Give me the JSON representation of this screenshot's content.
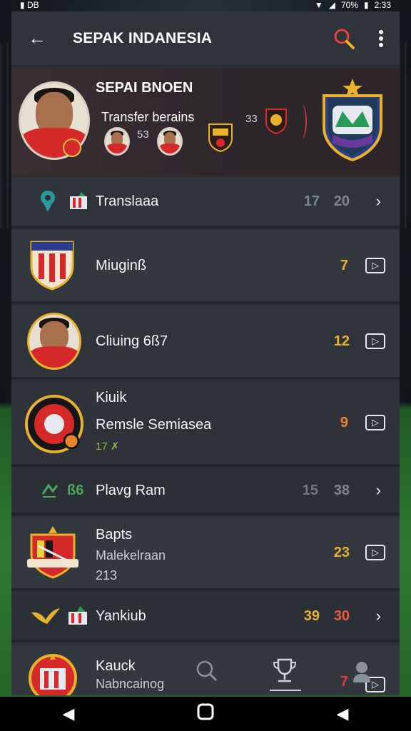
{
  "status": {
    "left": "▮ DB",
    "battery": "70%",
    "time": "2:33"
  },
  "appbar": {
    "title": "SEPAK INDANESIA"
  },
  "hero": {
    "name": "SEPAI BNOEN",
    "subtitle": "Transfer berains",
    "num1": "53",
    "num2": "33"
  },
  "rows": [
    {
      "label": "Translaaa",
      "value1": "17",
      "value2": "20",
      "color1": "#7d8590",
      "color2": "#7d8590"
    },
    {
      "label": "Miuginß",
      "value1": "7",
      "color1": "#e8b22a"
    },
    {
      "label": "Cliuing 6ß7",
      "value1": "12",
      "color1": "#e8b22a"
    },
    {
      "label": "Kiuik",
      "sub": "Remsle Semiasea",
      "tag": "17 ✗",
      "value1": "9",
      "color1": "#e8842a"
    },
    {
      "label": "Plavg Ram",
      "prefix": "ß6",
      "value1": "15",
      "value2": "38",
      "color1": "#6e7781",
      "color2": "#7d8590"
    },
    {
      "label": "Bapts",
      "sub": "Malekelraan",
      "tag": "213",
      "value1": "23",
      "color1": "#e8b22a"
    },
    {
      "label": "Yankiub",
      "value1": "39",
      "value2": "30",
      "color1": "#e8b22a",
      "color2": "#e85a3a"
    },
    {
      "label": "Kauck",
      "sub": "Nabncainog",
      "value1": "7",
      "color1": "#e83a3a"
    }
  ],
  "colors": {
    "accent_red": "#e8403a",
    "gold": "#e8b22a",
    "panel": "#2b3037"
  }
}
